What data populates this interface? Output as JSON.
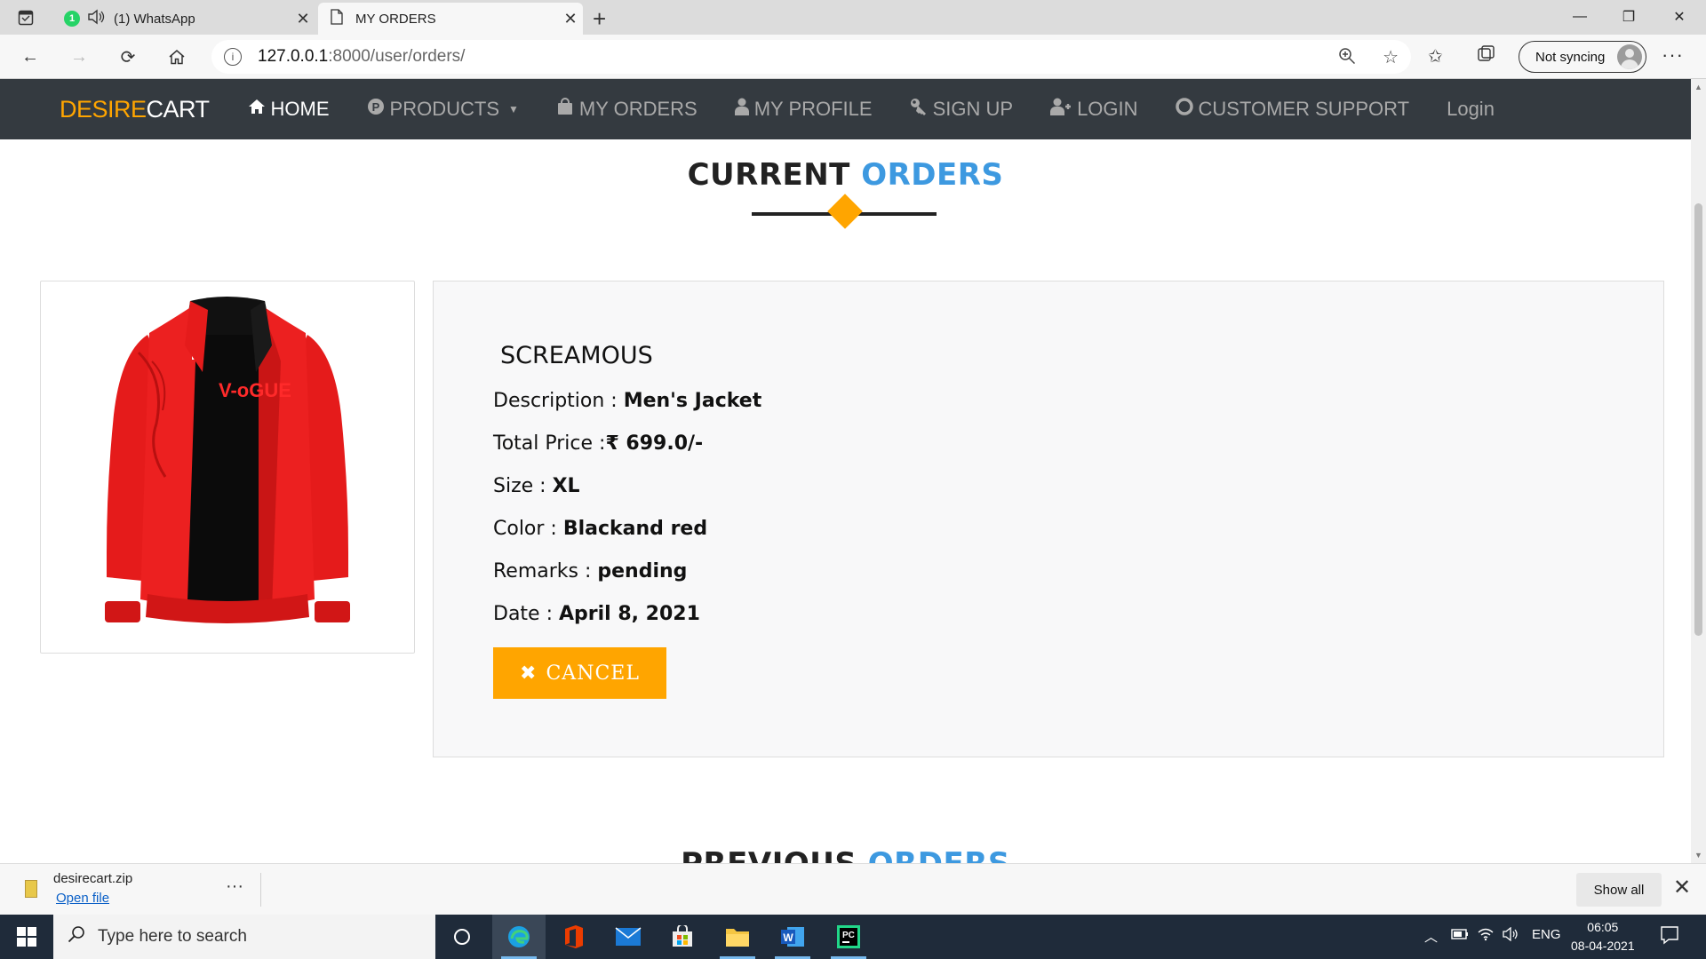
{
  "browser": {
    "tabs": [
      {
        "title": "(1) WhatsApp",
        "badge": "1"
      },
      {
        "title": "MY ORDERS"
      }
    ],
    "url": "127.0.0.1:8000/user/orders/",
    "url_host": "127.0.0.1",
    "url_rest": ":8000/user/orders/",
    "sync_label": "Not syncing"
  },
  "site": {
    "brand_a": "DESIRE",
    "brand_b": "CART",
    "nav": [
      {
        "label": "HOME",
        "icon": "home-icon"
      },
      {
        "label": "PRODUCTS",
        "icon": "products-icon"
      },
      {
        "label": "MY ORDERS",
        "icon": "shopping-bag-icon"
      },
      {
        "label": "MY PROFILE",
        "icon": "user-icon"
      },
      {
        "label": "SIGN UP",
        "icon": "key-icon"
      },
      {
        "label": "LOGIN",
        "icon": "user-plus-icon"
      },
      {
        "label": "CUSTOMER SUPPORT",
        "icon": "life-ring-icon"
      },
      {
        "label": "Login"
      }
    ]
  },
  "current_section": {
    "title_a": "CURRENT",
    "title_b": "ORDERS"
  },
  "order": {
    "product_name": "SCREAMOUS",
    "description_label": "Description : ",
    "description": "Men's Jacket",
    "price_label": "Total Price :",
    "price": "₹ 699.0/-",
    "size_label": "Size : ",
    "size": "XL",
    "color_label": "Color : ",
    "color": "Blackand red",
    "remarks_label": "Remarks : ",
    "remarks": "pending",
    "date_label": "Date : ",
    "date": "April 8, 2021",
    "cancel_label": "CANCEL",
    "jacket_print": "V-oGUE"
  },
  "previous_section": {
    "title_a": "PREVIOUS",
    "title_b": "ORDERS"
  },
  "download": {
    "filename": "desirecart.zip",
    "open_label": "Open file",
    "show_all": "Show all"
  },
  "taskbar": {
    "search_placeholder": "Type here to search",
    "lang": "ENG",
    "time": "06:05",
    "date": "08-04-2021"
  },
  "colors": {
    "accent": "#ffa500",
    "highlight": "#3d99e0",
    "nav_bg": "#343a40"
  }
}
